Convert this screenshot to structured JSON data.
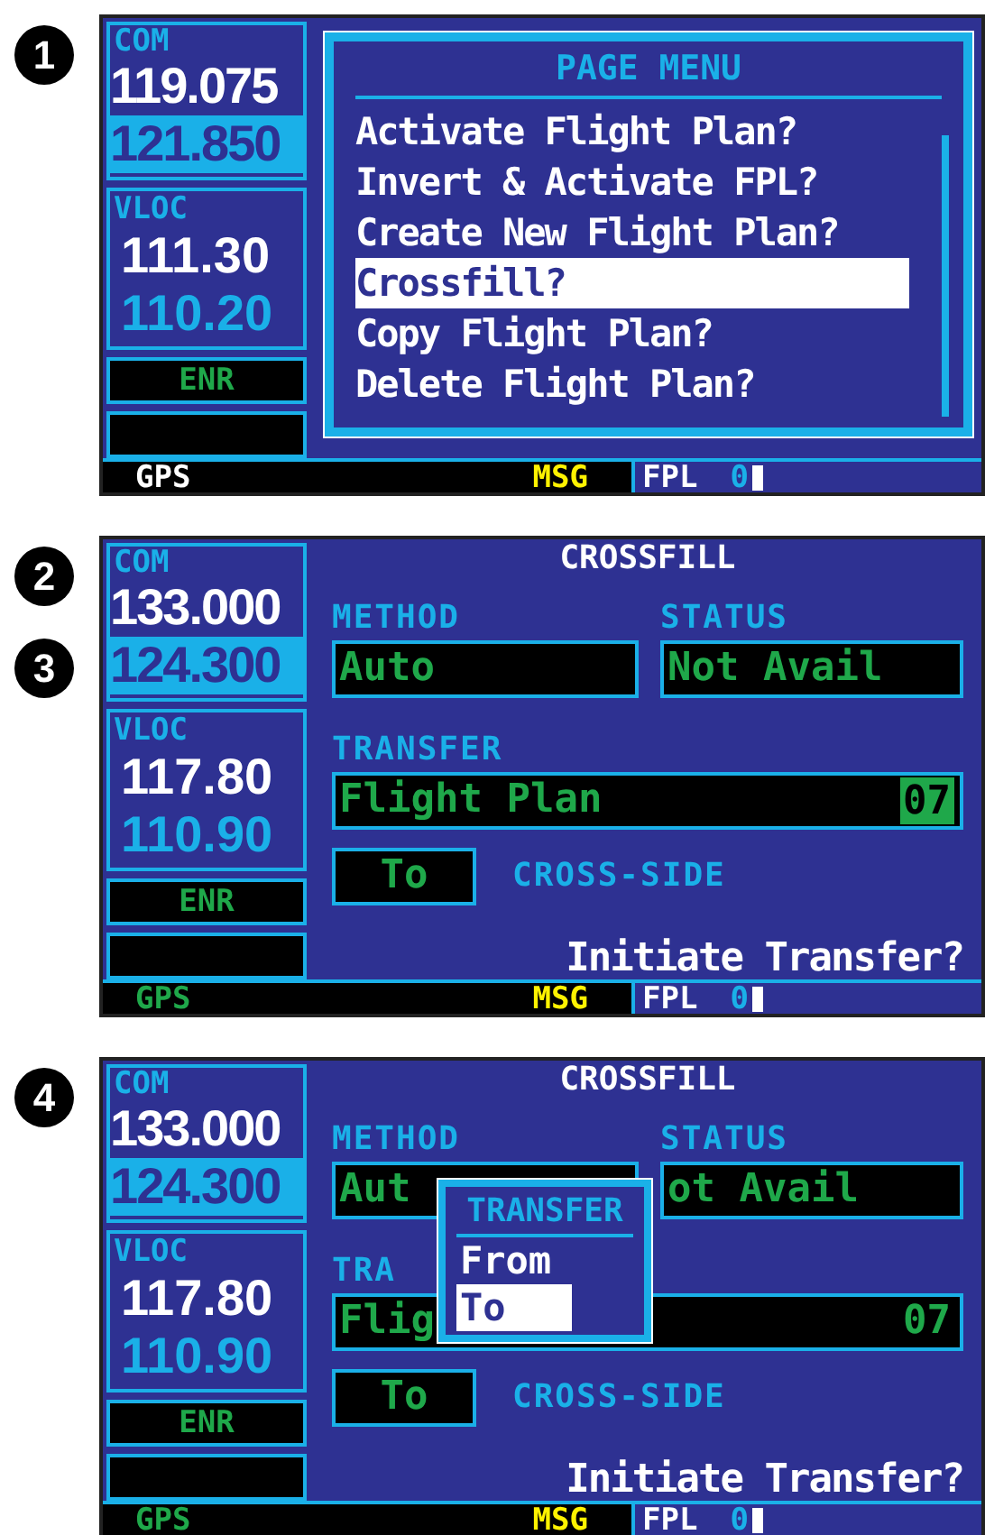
{
  "panels": [
    {
      "markers": [
        "1"
      ],
      "screen": {
        "radio": {
          "com_label": "COM",
          "com_active": "119.075",
          "com_standby": "121.850",
          "vloc_label": "VLOC",
          "vloc_active": "111.30",
          "vloc_standby": "110.20",
          "mode": "ENR"
        },
        "main": {
          "kind": "menu",
          "title": "PAGE MENU",
          "items": [
            {
              "label": "Activate Flight Plan?",
              "selected": false
            },
            {
              "label": "Invert & Activate FPL?",
              "selected": false
            },
            {
              "label": "Create New Flight Plan?",
              "selected": false
            },
            {
              "label": "Crossfill?",
              "selected": true
            },
            {
              "label": "Copy Flight Plan?",
              "selected": false
            },
            {
              "label": "Delete Flight Plan?",
              "selected": false
            }
          ]
        },
        "status_bar": {
          "source": {
            "text": "GPS",
            "active": false
          },
          "msg": "MSG",
          "page": "FPL",
          "page_index": "0"
        }
      }
    },
    {
      "markers": [
        "2",
        "3"
      ],
      "screen": {
        "radio": {
          "com_label": "COM",
          "com_active": "133.000",
          "com_standby": "124.300",
          "vloc_label": "VLOC",
          "vloc_active": "117.80",
          "vloc_standby": "110.90",
          "mode": "ENR"
        },
        "main": {
          "kind": "crossfill",
          "title": "CROSSFILL",
          "method_label": "METHOD",
          "method": "Auto",
          "status_label": "STATUS",
          "status": "Not Avail",
          "transfer_label": "TRANSFER",
          "transfer": "Flight Plan",
          "number": "07",
          "number_selected": true,
          "direction": "To",
          "cross_label": "CROSS-SIDE",
          "prompt": "Initiate Transfer?"
        },
        "status_bar": {
          "source": {
            "text": "GPS",
            "active": true
          },
          "msg": "MSG",
          "page": "FPL",
          "page_index": "0"
        }
      }
    },
    {
      "markers": [
        "4"
      ],
      "screen": {
        "radio": {
          "com_label": "COM",
          "com_active": "133.000",
          "com_standby": "124.300",
          "vloc_label": "VLOC",
          "vloc_active": "117.80",
          "vloc_standby": "110.90",
          "mode": "ENR"
        },
        "main": {
          "kind": "crossfill",
          "title": "CROSSFILL",
          "method_label": "METHOD",
          "method": "Aut",
          "status_label": "STATUS",
          "status": "ot Avail",
          "transfer_label": "TRA",
          "transfer": "Flig",
          "number": "07",
          "number_selected": false,
          "direction": "To",
          "cross_label": "CROSS-SIDE",
          "prompt": "Initiate Transfer?",
          "popup": {
            "title": "TRANSFER",
            "options": [
              {
                "label": "From",
                "selected": false
              },
              {
                "label": "To",
                "selected": true
              }
            ]
          }
        },
        "status_bar": {
          "source": {
            "text": "GPS",
            "active": true
          },
          "msg": "MSG",
          "page": "FPL",
          "page_index": "0"
        }
      }
    }
  ]
}
